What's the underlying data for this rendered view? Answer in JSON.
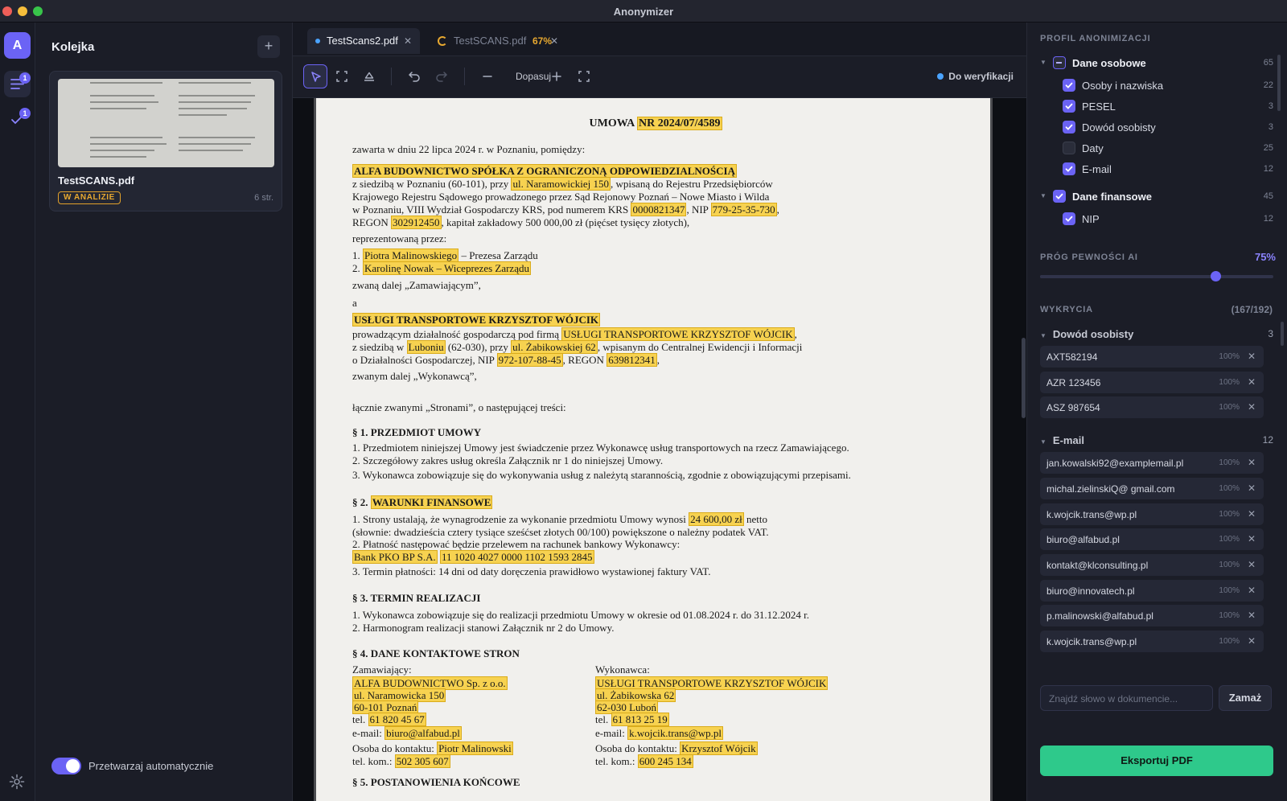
{
  "window": {
    "title": "Anonymizer"
  },
  "rail": {
    "avatar": "A",
    "queue_badge": "1",
    "done_badge": "1",
    "icons": [
      "list-icon",
      "check-icon",
      "gear-icon"
    ]
  },
  "queue": {
    "title": "Kolejka",
    "add_label": "+",
    "card": {
      "name": "TestSCANS.pdf",
      "status": "W ANALIZIE",
      "pages": "6 str."
    },
    "auto_process": {
      "label": "Przetwarzaj automatycznie",
      "on": true
    }
  },
  "tabs": [
    {
      "label": "TestScans2.pdf",
      "active": true
    },
    {
      "label": "TestSCANS.pdf",
      "progress": "67%",
      "active": false
    }
  ],
  "toolbar": {
    "zoom_label": "Dopasuj",
    "status": "Do weryfikacji"
  },
  "document": {
    "title": "UMOWA",
    "title_hl": "NR 2024/07/4589",
    "lines": [
      {
        "t": "zawarta w dniu 22 lipca 2024 r. w Poznaniu, pomiędzy:"
      },
      {
        "hl": "ALFA BUDOWNICTWO SPÓŁKA Z OGRANICZONĄ ODPOWIEDZIALNOŚCIĄ",
        "bold": true
      },
      {
        "t": "z siedzibą w Poznaniu (60-101), przy ",
        "hl": "ul. Naramowickiej 150",
        "t2": ", wpisaną do Rejestru Przedsiębiorców"
      },
      {
        "t": "Krajowego Rejestru Sądowego prowadzonego przez Sąd Rejonowy Poznań – Nowe Miasto i Wilda"
      },
      {
        "t": "w Poznaniu, VIII Wydział Gospodarczy KRS, pod numerem KRS ",
        "hl": "0000821347",
        "t2": ", NIP ",
        "hl2": "779-25-35-730",
        "t3": ","
      },
      {
        "t": "REGON ",
        "hl": "302912450",
        "t2": ", kapitał zakładowy 500 000,00 zł (pięćset tysięcy złotych),"
      },
      {
        "t": "reprezentowaną przez:"
      },
      {
        "t": "1.   ",
        "hl": "Piotra Malinowskiego",
        "t2": " – Prezesa Zarządu"
      },
      {
        "t": "2.   ",
        "hl": "Karolinę Nowak – Wiceprezes Zarządu"
      },
      {
        "t": "zwaną dalej „Zamawiającym”,"
      },
      {
        "t": "a"
      },
      {
        "hl": "USŁUGI TRANSPORTOWE KRZYSZTOF WÓJCIK",
        "bold": true
      },
      {
        "t": "prowadzącym działalność gospodarczą pod firmą ",
        "hl": "USŁUGI TRANSPORTOWE KRZYSZTOF WÓJCIK",
        "t2": ","
      },
      {
        "t": "z siedzibą w ",
        "hl": "Luboniu",
        "t2": " (62-030), przy ",
        "hl2": "ul. Żabikowskiej 62",
        "t3": ", wpisanym do Centralnej Ewidencji i Informacji"
      },
      {
        "t": "o Działalności Gospodarczej, NIP ",
        "hl": "972-107-88-45",
        "t2": ", REGON ",
        "hl2": "639812341",
        "t3": ","
      },
      {
        "t": "zwanym dalej „Wykonawcą”,"
      },
      {
        "t": "łącznie zwanymi „Stronami”, o następującej treści:"
      },
      {
        "t": "§ 1.  PRZEDMIOT UMOWY",
        "bold": true
      },
      {
        "t": "1.   Przedmiotem niniejszej Umowy jest świadczenie przez Wykonawcę usług transportowych na rzecz Zamawiającego."
      },
      {
        "t": "2.   Szczegółowy zakres usług określa Załącznik nr 1 do niniejszej Umowy."
      },
      {
        "t": "3.   Wykonawca zobowiązuje się do wykonywania usług z należytą starannością, zgodnie z obowiązującymi przepisami."
      },
      {
        "t": "§ 2.  ",
        "hl": "WARUNKI FINANSOWE",
        "bold": true
      },
      {
        "t": "1.   Strony ustalają, że wynagrodzenie za wykonanie przedmiotu Umowy wynosi ",
        "hl": "24 600,00 zł",
        "t2": " netto"
      },
      {
        "t": "      (słownie: dwadzieścia cztery tysiące sześćset złotych 00/100) powiększone o należny podatek VAT."
      },
      {
        "t": "2.   Płatność następować będzie przelewem na rachunek bankowy Wykonawcy:"
      },
      {
        "t": "      ",
        "hl": "Bank PKO BP S.A.",
        "t2": "    ",
        "hl2": "11 1020 4027 0000 1102 1593 2845"
      },
      {
        "t": "3.   Termin płatności: 14 dni od daty doręczenia prawidłowo wystawionej faktury VAT."
      },
      {
        "t": "§ 3.  TERMIN REALIZACJI",
        "bold": true
      },
      {
        "t": "1.   Wykonawca zobowiązuje się do realizacji przedmiotu Umowy w okresie od 01.08.2024 r. do 31.12.2024 r."
      },
      {
        "t": "2.   Harmonogram realizacji stanowi Załącznik nr 2 do Umowy."
      },
      {
        "t": "§ 4.  DANE KONTAKTOWE STRON",
        "bold": true
      },
      {
        "t": "§ 5.  POSTANOWIENIA KOŃCOWE",
        "bold": true
      }
    ],
    "contacts_left": [
      {
        "t": "Zamawiający:"
      },
      {
        "hl": "ALFA BUDOWNICTWO Sp. z o.o."
      },
      {
        "hl": "ul. Naramowicka 150"
      },
      {
        "hl": "60-101 Poznań"
      },
      {
        "t": "tel. ",
        "hl": "61 820 45 67"
      },
      {
        "t": "e-mail: ",
        "hl": "biuro@alfabud.pl"
      },
      {
        "t": "Osoba do kontaktu: ",
        "hl": "Piotr Malinowski"
      },
      {
        "t": "tel. kom.: ",
        "hl": "502 305 607"
      }
    ],
    "contacts_right": [
      {
        "t": "Wykonawca:"
      },
      {
        "hl": "USŁUGI TRANSPORTOWE KRZYSZTOF WÓJCIK"
      },
      {
        "hl": "ul. Żabikowska 62"
      },
      {
        "hl": "62-030 Luboń"
      },
      {
        "t": "tel. ",
        "hl": "61 813 25 19"
      },
      {
        "t": "e-mail: ",
        "hl": "k.wojcik.trans@wp.pl"
      },
      {
        "t": "Osoba do kontaktu: ",
        "hl": "Krzysztof Wójcik"
      },
      {
        "t": "tel. kom.: ",
        "hl": "600 245 134"
      }
    ]
  },
  "profile": {
    "heading": "PROFIL ANONIMIZACJI",
    "groups": [
      {
        "label": "Dane osobowe",
        "count": "65",
        "state": "partial",
        "items": [
          {
            "label": "Osoby i nazwiska",
            "count": "22",
            "checked": true
          },
          {
            "label": "PESEL",
            "count": "3",
            "checked": true
          },
          {
            "label": "Dowód osobisty",
            "count": "3",
            "checked": true
          },
          {
            "label": "Daty",
            "count": "25",
            "checked": false
          },
          {
            "label": "E-mail",
            "count": "12",
            "checked": true
          }
        ]
      },
      {
        "label": "Dane finansowe",
        "count": "45",
        "state": "checked",
        "items": [
          {
            "label": "NIP",
            "count": "12",
            "checked": true
          }
        ]
      }
    ]
  },
  "ai_threshold": {
    "heading": "PRÓG PEWNOŚCI AI",
    "value_label": "75%",
    "value": 0.75
  },
  "detections": {
    "heading": "WYKRYCIA",
    "count_label": "(167/192)",
    "groups": [
      {
        "label": "Dowód osobisty",
        "count": "3",
        "items": [
          {
            "value": "AXT582194",
            "conf": "100%"
          },
          {
            "value": "AZR 123456",
            "conf": "100%"
          },
          {
            "value": "ASZ 987654",
            "conf": "100%"
          }
        ]
      },
      {
        "label": "E-mail",
        "count": "12",
        "items": [
          {
            "value": "jan.kowalski92@examplemail.pl",
            "conf": "100%"
          },
          {
            "value": "michal.zielinskiQ@ gmail.com",
            "conf": "100%"
          },
          {
            "value": "k.wojcik.trans@wp.pl",
            "conf": "100%"
          },
          {
            "value": "biuro@alfabud.pl",
            "conf": "100%"
          },
          {
            "value": "kontakt@klconsulting.pl",
            "conf": "100%"
          },
          {
            "value": "biuro@innovatech.pl",
            "conf": "100%"
          },
          {
            "value": "p.malinowski@alfabud.pl",
            "conf": "100%"
          },
          {
            "value": "k.wojcik.trans@wp.pl",
            "conf": "100%"
          }
        ]
      }
    ]
  },
  "search": {
    "placeholder": "Znajdź słowo w dokumencie...",
    "button": "Zamaż"
  },
  "export": {
    "label": "Eksportuj PDF"
  },
  "colors": {
    "accent": "#6b63f5",
    "export": "#2ec98b",
    "warning": "#e8a930",
    "highlight": "#f7d250"
  }
}
